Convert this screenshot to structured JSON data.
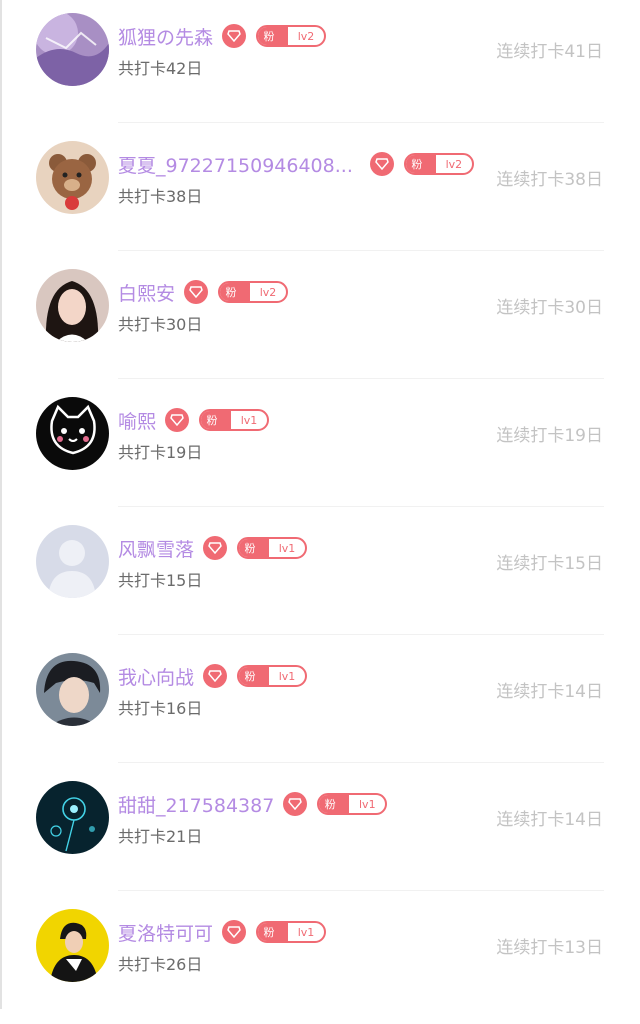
{
  "users": [
    {
      "name": "狐狸の先森",
      "level": "lv2",
      "fan_label": "粉",
      "total": "共打卡42日",
      "streak": "连续打卡41日",
      "avatar": "purple-sky"
    },
    {
      "name": "夏夏_97227150946408...",
      "level": "lv2",
      "fan_label": "粉",
      "total": "共打卡38日",
      "streak": "连续打卡38日",
      "avatar": "bear"
    },
    {
      "name": "白熙安",
      "level": "lv2",
      "fan_label": "粉",
      "total": "共打卡30日",
      "streak": "连续打卡30日",
      "avatar": "girl"
    },
    {
      "name": "喻熙",
      "level": "lv1",
      "fan_label": "粉",
      "total": "共打卡19日",
      "streak": "连续打卡19日",
      "avatar": "cat"
    },
    {
      "name": "风飘雪落",
      "level": "lv1",
      "fan_label": "粉",
      "total": "共打卡15日",
      "streak": "连续打卡15日",
      "avatar": "default-user"
    },
    {
      "name": "我心向战",
      "level": "lv1",
      "fan_label": "粉",
      "total": "共打卡16日",
      "streak": "连续打卡14日",
      "avatar": "man"
    },
    {
      "name": "甜甜_217584387",
      "level": "lv1",
      "fan_label": "粉",
      "total": "共打卡21日",
      "streak": "连续打卡14日",
      "avatar": "flower-dark"
    },
    {
      "name": "夏洛特可可",
      "level": "lv1",
      "fan_label": "粉",
      "total": "共打卡26日",
      "streak": "连续打卡13日",
      "avatar": "yellow-man"
    }
  ],
  "colors": {
    "name": "#b48be3",
    "accent": "#f06a73",
    "muted": "#c3c3c3",
    "sub": "#6b6b6b"
  }
}
